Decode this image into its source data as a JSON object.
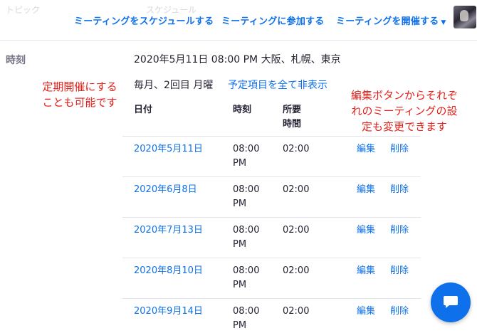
{
  "topnav": {
    "faded_left": "トピック",
    "faded_middle": "スケジュール",
    "schedule_label": "ミーティングをスケジュールする",
    "join_label": "ミーティングに参加する",
    "host_label": "ミーティングを開催する",
    "host_caret": "▼"
  },
  "time_section": {
    "label": "時刻",
    "datetime": "2020年5月11日 08:00 PM 大阪、札幌、東京",
    "recurrence": "毎月、2回目 月曜",
    "hide_all_link": "予定項目を全て非表示"
  },
  "annotations": {
    "left_line1": "定期開催にする",
    "left_line2": "ことも可能です",
    "right_line1": "編集ボタンからそれぞ",
    "right_line2": "れのミーティングの設",
    "right_line3": "定も変更できます"
  },
  "occurrences": {
    "headers": {
      "date": "日付",
      "time": "時刻",
      "duration_line1": "所要",
      "duration_line2": "時間"
    },
    "rows": [
      {
        "date": "2020年5月11日",
        "time_line1": "08:00",
        "time_line2": "PM",
        "duration": "02:00",
        "edit": "編集",
        "delete": "削除"
      },
      {
        "date": "2020年6月8日",
        "time_line1": "08:00",
        "time_line2": "PM",
        "duration": "02:00",
        "edit": "編集",
        "delete": "削除"
      },
      {
        "date": "2020年7月13日",
        "time_line1": "08:00",
        "time_line2": "PM",
        "duration": "02:00",
        "edit": "編集",
        "delete": "削除"
      },
      {
        "date": "2020年8月10日",
        "time_line1": "08:00",
        "time_line2": "PM",
        "duration": "02:00",
        "edit": "編集",
        "delete": "削除"
      },
      {
        "date": "2020年9月14日",
        "time_line1": "08:00",
        "time_line2": "PM",
        "duration": "02:00",
        "edit": "編集",
        "delete": "削除"
      }
    ]
  },
  "colors": {
    "link": "#0e71eb",
    "annotation": "#e4211b",
    "text": "#232333",
    "label": "#747487"
  },
  "icons": {
    "chat": "chat-bubble-icon",
    "avatar": "user-avatar"
  }
}
